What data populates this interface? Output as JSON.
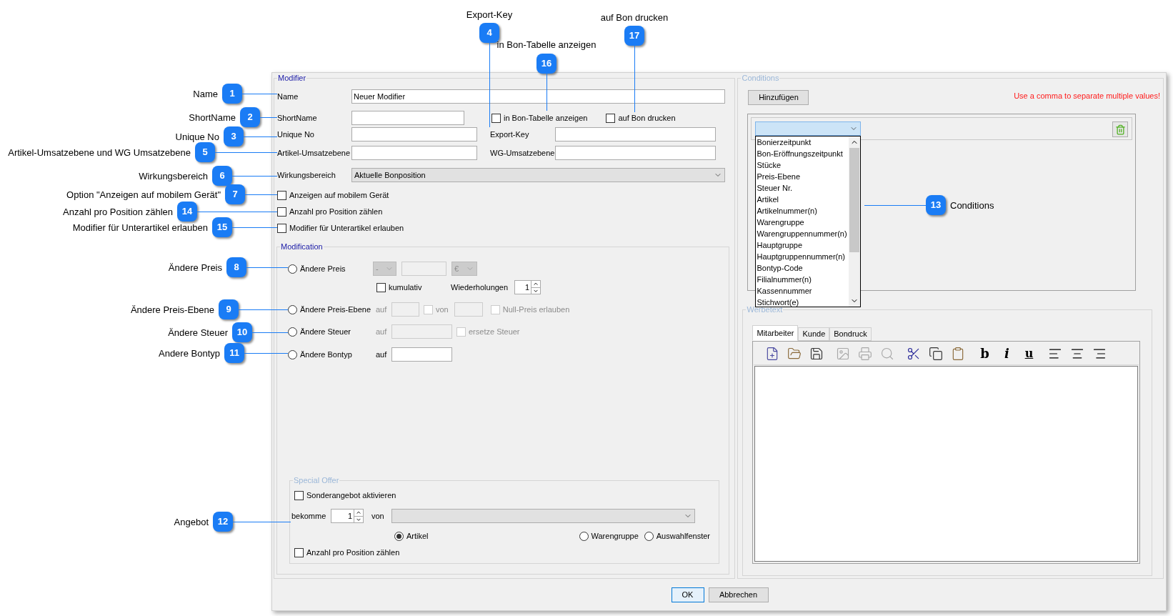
{
  "callouts": [
    {
      "kind": "top",
      "number": "4",
      "label": "Export-Key"
    },
    {
      "kind": "top",
      "number": "17",
      "label": "auf Bon drucken"
    },
    {
      "kind": "top",
      "number": "16",
      "label": "in Bon-Tabelle anzeigen"
    },
    {
      "kind": "left",
      "number": "1",
      "label": "Name"
    },
    {
      "kind": "left",
      "number": "2",
      "label": "ShortName"
    },
    {
      "kind": "left",
      "number": "3",
      "label": "Unique No"
    },
    {
      "kind": "left",
      "number": "5",
      "label": "Artikel-Umsatzebene und WG Umsatzebene"
    },
    {
      "kind": "left",
      "number": "6",
      "label": "Wirkungsbereich"
    },
    {
      "kind": "left",
      "number": "7",
      "label": "Option \"Anzeigen auf mobilem Gerät\""
    },
    {
      "kind": "left",
      "number": "14",
      "label": "Anzahl pro Position zählen"
    },
    {
      "kind": "left",
      "number": "15",
      "label": "Modifier für Unterartikel erlauben"
    },
    {
      "kind": "right",
      "number": "13",
      "label": "Conditions"
    },
    {
      "kind": "left",
      "number": "8",
      "label": "Ändere Preis"
    },
    {
      "kind": "left",
      "number": "9",
      "label": "Ändere Preis-Ebene"
    },
    {
      "kind": "left",
      "number": "10",
      "label": "Ändere Steuer"
    },
    {
      "kind": "left",
      "number": "11",
      "label": "Andere Bontyp"
    },
    {
      "kind": "left",
      "number": "12",
      "label": "Angebot"
    }
  ],
  "modifier": {
    "legend": "Modifier",
    "disabled": false,
    "name": {
      "label": "Name",
      "value": "Neuer Modifier"
    },
    "short_name": {
      "label": "ShortName"
    },
    "show_in_table": {
      "label": "in Bon-Tabelle anzeigen",
      "checked": false
    },
    "print_on_receipt": {
      "label": "auf Bon drucken",
      "checked": false
    },
    "unique_no": {
      "label": "Unique No"
    },
    "export_key": {
      "label": "Export-Key"
    },
    "article_level": {
      "label": "Artikel-Umsatzebene"
    },
    "group_level": {
      "label": "WG-Umsatzebene"
    },
    "scope": {
      "label": "Wirkungsbereich",
      "value": "Aktuelle Bonposition"
    },
    "options": [
      {
        "label": "Anzeigen auf mobilem Gerät",
        "checked": false
      },
      {
        "label": "Anzahl pro Position zählen",
        "checked": false
      },
      {
        "label": "Modifier für Unterartikel erlauben",
        "checked": false
      }
    ]
  },
  "modification": {
    "legend": "Modification",
    "disabled": false,
    "price": {
      "label": "Ändere Preis",
      "selected": false,
      "amount_disabled": true,
      "sign": "-",
      "currency": "€",
      "cumulative": {
        "label": "kumulativ",
        "checked": false
      },
      "repeat_label": "Wiederholungen",
      "repeat": "1"
    },
    "price_level": {
      "label": "Ändere Preis-Ebene",
      "selected": false,
      "disabled": true,
      "to_label": "auf",
      "from": {
        "label": "von",
        "checked": false
      },
      "null_price": {
        "label": "Null-Preis erlauben",
        "checked": false
      }
    },
    "tax": {
      "label": "Ändere Steuer",
      "selected": false,
      "disabled": true,
      "to_label": "auf",
      "replace": {
        "label": "ersetze Steuer",
        "checked": false
      }
    },
    "receipt_type": {
      "label": "Ändere Bontyp",
      "selected": false,
      "disabled": false,
      "to_label": "auf"
    }
  },
  "special_offer": {
    "legend": "Special Offer",
    "disabled": true,
    "activate": {
      "label": "Sonderangebot aktivieren",
      "checked": false
    },
    "get_label": "bekomme",
    "get_count": "1",
    "of_label": "von",
    "targets": [
      {
        "label": "Artikel",
        "selected": true
      },
      {
        "label": "Warengruppe",
        "selected": false
      },
      {
        "label": "Auswahlfenster",
        "selected": false
      }
    ],
    "count_per_position": {
      "label": "Anzahl pro Position zählen",
      "checked": false
    }
  },
  "conditions": {
    "legend": "Conditions",
    "disabled": true,
    "add_button": "Hinzufügen",
    "hint": "Use a comma to separate multiple values!",
    "options": [
      "Bonierzeitpunkt",
      "Bon-Eröffnungszeitpunkt",
      "Stücke",
      "Preis-Ebene",
      "Steuer Nr.",
      "Artikel",
      "Artikelnummer(n)",
      "Warengruppe",
      "Warengruppennummer(n)",
      "Hauptgruppe",
      "Hauptgruppennummer(n)",
      "Bontyp-Code",
      "Filialnummer(n)",
      "Kassennummer",
      "Stichwort(e)"
    ]
  },
  "ad_text": {
    "legend": "Werbetext",
    "disabled": true,
    "tabs": [
      {
        "label": "Mitarbeiter",
        "selected": true
      },
      {
        "label": "Kunde",
        "selected": false
      },
      {
        "label": "Bondruck",
        "selected": false
      }
    ],
    "toolbar": [
      {
        "kind": "new",
        "disabled": false
      },
      {
        "kind": "open",
        "disabled": false
      },
      {
        "kind": "save",
        "disabled": false
      },
      {
        "kind": "picture",
        "disabled": true
      },
      {
        "kind": "print",
        "disabled": true
      },
      {
        "kind": "preview",
        "disabled": true
      },
      {
        "kind": "cut",
        "disabled": false
      },
      {
        "kind": "copy",
        "disabled": false
      },
      {
        "kind": "paste",
        "disabled": false
      },
      {
        "kind": "bold",
        "text": "b",
        "disabled": false
      },
      {
        "kind": "italic",
        "text": "i",
        "disabled": false
      },
      {
        "kind": "underline",
        "text": "u",
        "disabled": false
      },
      {
        "kind": "align-left",
        "disabled": false
      },
      {
        "kind": "align-center",
        "disabled": false
      },
      {
        "kind": "align-right",
        "disabled": false
      }
    ]
  },
  "buttons": [
    {
      "label": "OK",
      "default": true
    },
    {
      "label": "Abbrechen",
      "default": false
    }
  ]
}
